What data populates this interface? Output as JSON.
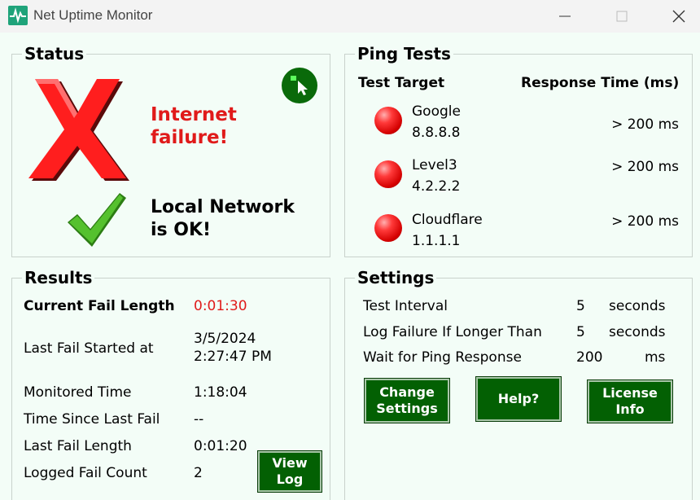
{
  "window": {
    "title": "Net Uptime Monitor"
  },
  "status": {
    "title": "Status",
    "internet_line1": "Internet",
    "internet_line2": "failure!",
    "local_line1": "Local Network",
    "local_line2": "is OK!"
  },
  "ping": {
    "title": "Ping Tests",
    "col_target": "Test Target",
    "col_response": "Response Time (ms)",
    "targets": [
      {
        "name": "Google",
        "ip": "8.8.8.8",
        "response": "> 200 ms",
        "state_color": "#e01a1a"
      },
      {
        "name": "Level3",
        "ip": "4.2.2.2",
        "response": "> 200 ms",
        "state_color": "#e01a1a"
      },
      {
        "name": "Cloudflare",
        "ip": "1.1.1.1",
        "response": "> 200 ms",
        "state_color": "#e01a1a"
      }
    ]
  },
  "results": {
    "title": "Results",
    "current_fail_length_label": "Current Fail Length",
    "current_fail_length_value": "0:01:30",
    "last_fail_started_label": "Last Fail Started at",
    "last_fail_started_date": "3/5/2024",
    "last_fail_started_time": "2:27:47 PM",
    "monitored_time_label": "Monitored Time",
    "monitored_time_value": "1:18:04",
    "time_since_last_fail_label": "Time Since Last Fail",
    "time_since_last_fail_value": "--",
    "last_fail_length_label": "Last Fail Length",
    "last_fail_length_value": "0:01:20",
    "logged_fail_count_label": "Logged Fail Count",
    "logged_fail_count_value": "2",
    "view_log_label": "View\nLog"
  },
  "settings": {
    "title": "Settings",
    "test_interval_label": "Test Interval",
    "test_interval_value": "5",
    "test_interval_unit": "seconds",
    "log_failure_label": "Log Failure If Longer Than",
    "log_failure_value": "5",
    "log_failure_unit": "seconds",
    "wait_ping_label": "Wait for Ping Response",
    "wait_ping_value": "200",
    "wait_ping_unit": "ms",
    "change_settings_label": "Change\nSettings",
    "help_label": "Help?",
    "license_label": "License\nInfo"
  },
  "colors": {
    "accent_green": "#036003",
    "fail_red": "#e01a1a",
    "ok_green": "#3ea81d",
    "background": "#f3fdf7"
  }
}
